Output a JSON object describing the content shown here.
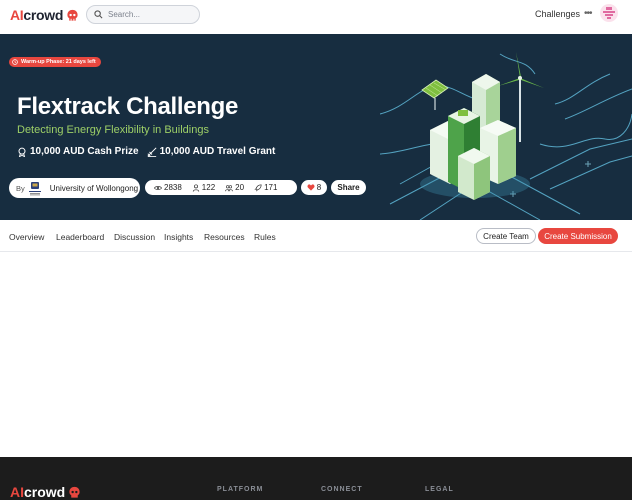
{
  "nav": {
    "logo_ai": "AI",
    "logo_crowd": "crowd",
    "search_placeholder": "Search...",
    "challenges": "Challenges",
    "more": "•••"
  },
  "hero": {
    "phase_badge": "Warm-up Phase: 21 days left",
    "title": "Flextrack Challenge",
    "subtitle": "Detecting Energy Flexibility in Buildings",
    "prizes": [
      "10,000 AUD Cash Prize",
      "10,000 AUD Travel Grant"
    ],
    "by_label": "By",
    "organizer": "University of Wollongong",
    "stats": {
      "views": "2838",
      "participants": "122",
      "teams": "20",
      "submissions": "171"
    },
    "likes": "8",
    "share": "Share"
  },
  "tabs": [
    "Overview",
    "Leaderboard",
    "Discussion",
    "Insights",
    "Resources",
    "Rules"
  ],
  "actions": {
    "create_team": "Create Team",
    "create_submission": "Create Submission"
  },
  "footer": {
    "logo_ai": "AI",
    "logo_crowd": "crowd",
    "headings": [
      "PLATFORM",
      "CONNECT",
      "LEGAL"
    ]
  },
  "colors": {
    "brand_red": "#e8473f",
    "hero_bg": "#172d40",
    "accent_green": "#9dcf67",
    "footer_bg": "#1c1c1c"
  }
}
